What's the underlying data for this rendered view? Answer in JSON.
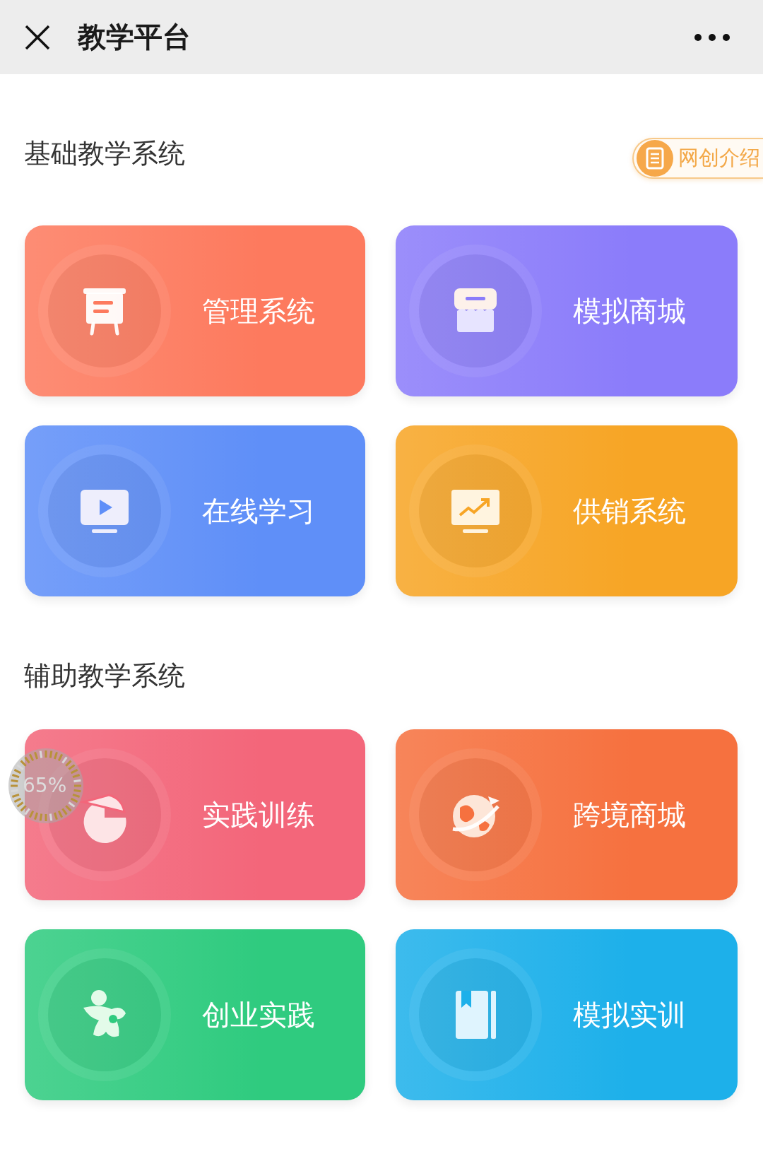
{
  "top_bar": {
    "title": "教学平台"
  },
  "sections": [
    {
      "heading": "基础教学系统",
      "badge": {
        "label": "网创介绍"
      },
      "cards": [
        {
          "label": "管理系统",
          "kind": "easel",
          "color": "#fd7a5e"
        },
        {
          "label": "模拟商城",
          "kind": "shop",
          "color": "#8b7cfa"
        },
        {
          "label": "在线学习",
          "kind": "play",
          "color": "#5f8ff8"
        },
        {
          "label": "供销系统",
          "kind": "chart",
          "color": "#f7a525"
        }
      ]
    },
    {
      "heading": "辅助教学系统",
      "cards": [
        {
          "label": "实践训练",
          "kind": "pie",
          "color": "#f3667a"
        },
        {
          "label": "跨境商城",
          "kind": "globe",
          "color": "#f6713f"
        },
        {
          "label": "创业实践",
          "kind": "figure",
          "color": "#2fcb7f"
        },
        {
          "label": "模拟实训",
          "kind": "book",
          "color": "#1db0ea"
        }
      ]
    }
  ],
  "progress_overlay": {
    "label": "65%"
  }
}
